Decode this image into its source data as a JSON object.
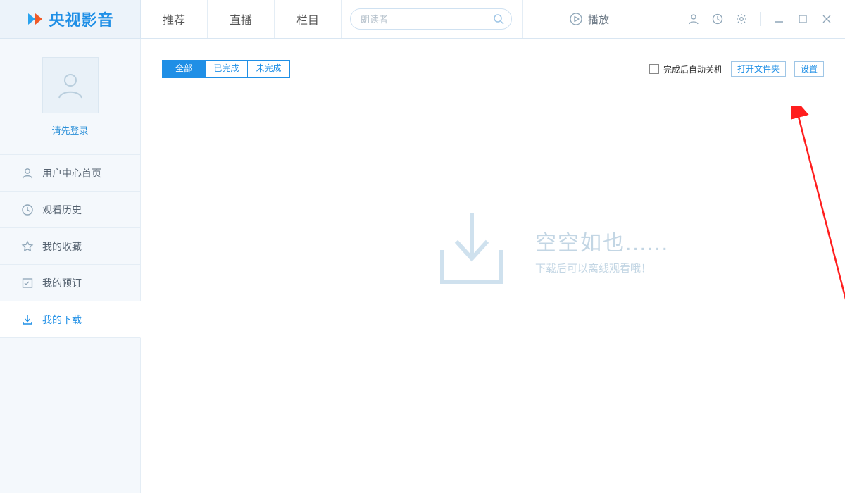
{
  "logo_text": "央视影音",
  "top_tabs": {
    "t0": "推荐",
    "t1": "直播",
    "t2": "栏目"
  },
  "search_placeholder": "朗读者",
  "play_label": "播放",
  "login_link": "请先登录",
  "sidebar": {
    "s0": "用户中心首页",
    "s1": "观看历史",
    "s2": "我的收藏",
    "s3": "我的预订",
    "s4": "我的下载"
  },
  "filters": {
    "f0": "全部",
    "f1": "已完成",
    "f2": "未完成"
  },
  "auto_shutdown": "完成后自动关机",
  "open_folder": "打开文件夹",
  "settings": "设置",
  "empty_title": "空空如也......",
  "empty_sub": "下载后可以离线观看哦！"
}
